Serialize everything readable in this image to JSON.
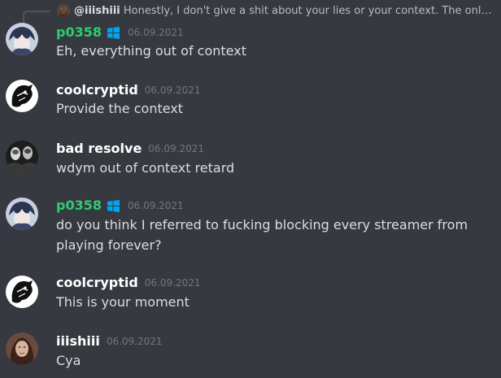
{
  "reply_preview": {
    "mention": "@iiishiii",
    "text": "Honestly, I don't give a shit about your lies or your context. The only pe..."
  },
  "messages": [
    {
      "username": "p0358",
      "timestamp": "06.09.2021",
      "username_color": "#2ecc71",
      "badge_icon": "windows-logo-icon",
      "content": "Eh, everything out of context"
    },
    {
      "username": "coolcryptid",
      "timestamp": "06.09.2021",
      "content": "Provide the context"
    },
    {
      "username": "bad resolve",
      "timestamp": "06.09.2021",
      "content": "wdym out of context retard"
    },
    {
      "username": "p0358",
      "timestamp": "06.09.2021",
      "username_color": "#2ecc71",
      "badge_icon": "windows-logo-icon",
      "content": "do you think I referred to fucking blocking every streamer from playing forever?"
    },
    {
      "username": "coolcryptid",
      "timestamp": "06.09.2021",
      "content": "This is your moment"
    },
    {
      "username": "iiishiii",
      "timestamp": "06.09.2021",
      "content": "Cya"
    }
  ],
  "colors": {
    "background": "#36393f",
    "text": "#dcddde",
    "timestamp": "#72767d",
    "windows_badge": "#00a4ef"
  }
}
